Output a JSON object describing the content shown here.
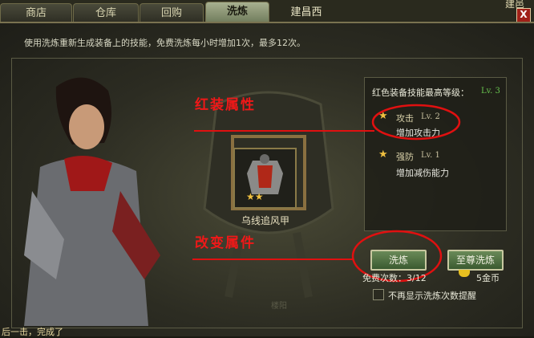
{
  "window": {
    "corner_text": "建邑"
  },
  "tabs": [
    {
      "label": "商店"
    },
    {
      "label": "仓库"
    },
    {
      "label": "回购"
    },
    {
      "label": "洗炼"
    },
    {
      "label": "建昌西"
    }
  ],
  "close_label": "X",
  "hint": "使用洗炼重新生成装备上的技能，免费洗炼每小时增加1次，最多12次。",
  "item": {
    "name": "乌线追风甲",
    "stars": "★★"
  },
  "skills": {
    "title": "红色装备技能最高等级：",
    "max_level": "Lv. 3",
    "list": [
      {
        "name": "攻击",
        "level": "Lv. 2",
        "desc": "增加攻击力"
      },
      {
        "name": "强防",
        "level": "Lv. 1",
        "desc": "增加减伤能力"
      }
    ]
  },
  "annotations": {
    "top": "红装属性",
    "bottom": "改变属件"
  },
  "buttons": {
    "refine": "洗炼",
    "premium": "至尊洗炼"
  },
  "free_count": "免费次数：3/12",
  "gold_cost": "5金币",
  "checkbox_label": "不再显示洗炼次数提醒",
  "map_label": "楼阳",
  "bottom_text": "后一击，完成了",
  "colors": {
    "accent_red": "#e01010",
    "level_green": "#6ac850",
    "star_gold": "#f0c040"
  }
}
